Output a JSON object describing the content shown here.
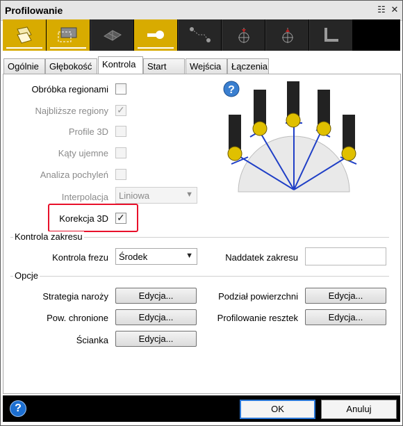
{
  "window": {
    "title": "Profilowanie",
    "pin_icon": "pin-icon",
    "close_icon": "close-icon"
  },
  "toolbar": {
    "tools": [
      {
        "name": "surface-tool",
        "active": true
      },
      {
        "name": "boundary-tool",
        "active": true
      },
      {
        "name": "mesh-tool",
        "active": false
      },
      {
        "name": "tool-holder-tool",
        "active": true
      },
      {
        "name": "path-tool",
        "active": false
      },
      {
        "name": "lead-in-tool",
        "active": false
      },
      {
        "name": "lead-out-tool",
        "active": false
      },
      {
        "name": "link-tool",
        "active": false
      }
    ],
    "colors": {
      "active": "#d8ab00",
      "inactive": "#262626"
    }
  },
  "tabs": [
    "Ogólnie",
    "Głębokość",
    "Kontrola",
    "Start",
    "Wejścia",
    "Łączenia"
  ],
  "active_tab": "Kontrola",
  "kontrola": {
    "obrobka_regionami": {
      "label": "Obróbka regionami",
      "checked": false,
      "enabled": true
    },
    "najblizsze_regiony": {
      "label": "Najbliższe regiony",
      "checked": true,
      "enabled": false
    },
    "profile_3d": {
      "label": "Profile 3D",
      "checked": false,
      "enabled": false
    },
    "katy_ujemne": {
      "label": "Kąty ujemne",
      "checked": false,
      "enabled": false
    },
    "analiza_pochylen": {
      "label": "Analiza pochyleń",
      "checked": false,
      "enabled": false
    },
    "interpolacja": {
      "label": "Interpolacja",
      "value": "Liniowa",
      "enabled": false
    },
    "korekcja_3d": {
      "label": "Korekcja 3D",
      "checked": true,
      "enabled": true
    }
  },
  "kontrola_zakresu": {
    "group_label": "Kontrola zakresu",
    "kontrola_frezu": {
      "label": "Kontrola frezu",
      "value": "Środek"
    },
    "naddatek_zakresu": {
      "label": "Naddatek zakresu",
      "value": ""
    }
  },
  "opcje": {
    "group_label": "Opcje",
    "strategia_narozy": {
      "label": "Strategia naroży",
      "button": "Edycja..."
    },
    "pow_chronione": {
      "label": "Pow. chronione",
      "button": "Edycja..."
    },
    "scianka": {
      "label": "Ścianka",
      "button": "Edycja..."
    },
    "podzial_powierzchni": {
      "label": "Podział powierzchni",
      "button": "Edycja..."
    },
    "profilowanie_resztek": {
      "label": "Profilowanie resztek",
      "button": "Edycja..."
    }
  },
  "illustration_help": "?",
  "footer": {
    "help_icon": "help-icon",
    "help_glyph": "?",
    "ok": "OK",
    "cancel": "Anuluj"
  },
  "highlight_color": "#e8102a"
}
